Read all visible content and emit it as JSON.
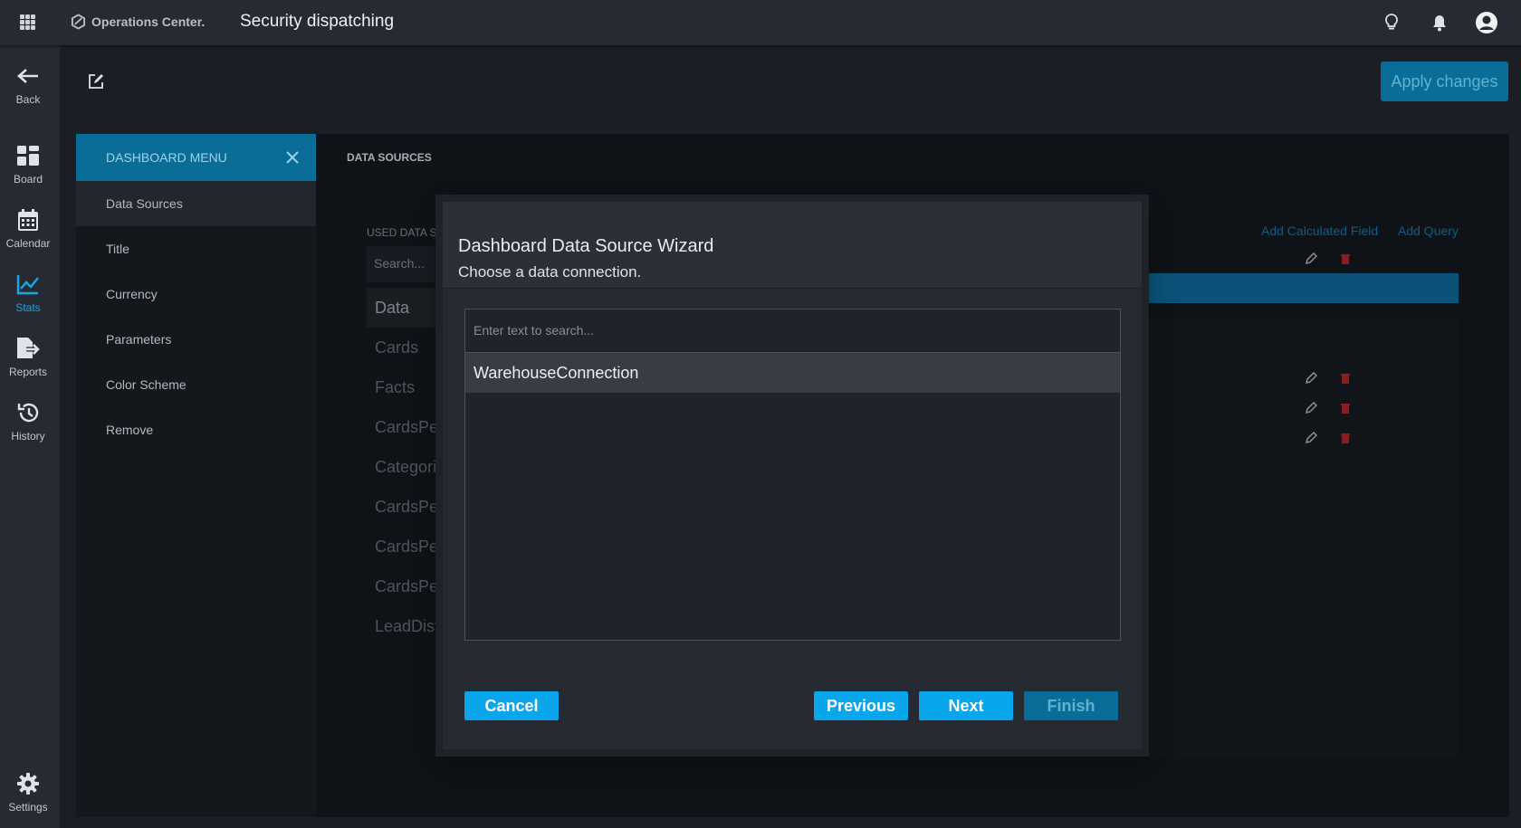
{
  "app": {
    "brand": "Operations Center.",
    "title": "Security dispatching"
  },
  "nav": {
    "items": [
      {
        "label": "Back",
        "icon": "arrow-left-icon"
      },
      {
        "label": "Board",
        "icon": "board-icon"
      },
      {
        "label": "Calendar",
        "icon": "calendar-icon"
      },
      {
        "label": "Stats",
        "icon": "stats-icon",
        "active": true
      },
      {
        "label": "Reports",
        "icon": "reports-icon"
      },
      {
        "label": "History",
        "icon": "history-icon"
      },
      {
        "label": "Settings",
        "icon": "gear-icon"
      }
    ]
  },
  "toolbar": {
    "apply_label": "Apply changes"
  },
  "dashboard_menu": {
    "title": "DASHBOARD MENU",
    "items": [
      "Data Sources",
      "Title",
      "Currency",
      "Parameters",
      "Color Scheme",
      "Remove"
    ],
    "active": "Data Sources"
  },
  "data_sources": {
    "title": "DATA SOURCES",
    "used_label": "USED DATA SOURCES",
    "search_placeholder": "Search...",
    "items": [
      "Data",
      "Cards",
      "Facts",
      "CardsPer",
      "Categorie",
      "CardsPer",
      "CardsPer",
      "CardsPer",
      "LeadDistr"
    ],
    "add_calculated_field": "Add Calculated Field",
    "add_query": "Add Query"
  },
  "wizard": {
    "title": "Dashboard Data Source Wizard",
    "subtitle": "Choose a data connection.",
    "search_placeholder": "Enter text to search...",
    "connections": [
      "WarehouseConnection"
    ],
    "buttons": {
      "cancel": "Cancel",
      "previous": "Previous",
      "next": "Next",
      "finish": "Finish"
    }
  },
  "colors": {
    "accent": "#0aa6ec",
    "accent_dim": "#0a6d97",
    "danger": "#c0392b",
    "topbar": "#252a33"
  }
}
